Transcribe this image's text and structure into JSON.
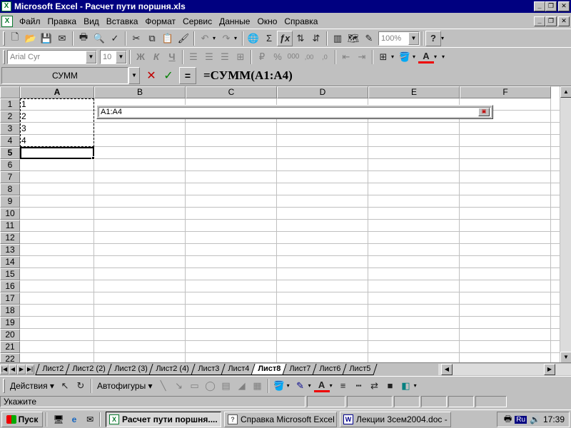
{
  "window": {
    "title": "Microsoft Excel - Расчет пути поршня.xls",
    "app_icon": "excel-icon"
  },
  "menu": {
    "items": [
      {
        "label": "Файл",
        "key": "Ф"
      },
      {
        "label": "Правка",
        "key": "П"
      },
      {
        "label": "Вид",
        "key": "В"
      },
      {
        "label": "Вставка",
        "key": "с"
      },
      {
        "label": "Формат",
        "key": "о"
      },
      {
        "label": "Сервис",
        "key": "е"
      },
      {
        "label": "Данные",
        "key": "Д"
      },
      {
        "label": "Окно",
        "key": "О"
      },
      {
        "label": "Справка",
        "key": "С"
      }
    ]
  },
  "standard_toolbar": {
    "zoom": "100%"
  },
  "format_toolbar": {
    "font": "Arial Cyr",
    "size": "10",
    "bold": "Ж",
    "italic": "К",
    "underline": "Ч"
  },
  "formula_bar": {
    "name_box": "СУММ",
    "cancel": "✕",
    "enter": "✓",
    "equals": "=",
    "formula": "=СУММ(A1:A4)"
  },
  "grid": {
    "columns": [
      "A",
      "B",
      "C",
      "D",
      "E",
      "F"
    ],
    "rows": [
      "1",
      "2",
      "3",
      "4",
      "5",
      "6",
      "7",
      "8",
      "9",
      "10",
      "11",
      "12",
      "13",
      "14",
      "15",
      "16",
      "17",
      "18",
      "19",
      "20",
      "21",
      "22"
    ],
    "cells": {
      "A1": "1",
      "A2": "2",
      "A3": "3",
      "A4": "4"
    },
    "active_cell": "A5",
    "ref_box_value": "A1:A4"
  },
  "sheet_tabs": [
    {
      "label": "Лист2",
      "active": false
    },
    {
      "label": "Лист2 (2)",
      "active": false
    },
    {
      "label": "Лист2 (3)",
      "active": false
    },
    {
      "label": "Лист2 (4)",
      "active": false
    },
    {
      "label": "Лист3",
      "active": false
    },
    {
      "label": "Лист4",
      "active": false
    },
    {
      "label": "Лист8",
      "active": true
    },
    {
      "label": "Лист7",
      "active": false
    },
    {
      "label": "Лист6",
      "active": false
    },
    {
      "label": "Лист5",
      "active": false
    }
  ],
  "drawing_toolbar": {
    "actions": "Действия",
    "autoshapes": "Автофигуры"
  },
  "status": {
    "text": "Укажите"
  },
  "taskbar": {
    "start": "Пуск",
    "tasks": [
      {
        "label": "Расчет пути поршня....",
        "active": true,
        "icon": "excel-icon"
      },
      {
        "label": "Справка Microsoft Excel",
        "active": false,
        "icon": "help-icon"
      },
      {
        "label": "Лекции 3сем2004.doc - ...",
        "active": false,
        "icon": "word-icon"
      }
    ],
    "lang": "Ru",
    "clock": "17:39"
  },
  "colors": {
    "titlebar": "#000080",
    "face": "#c0c0c0",
    "cancel": "#c00000",
    "enter": "#008000"
  }
}
